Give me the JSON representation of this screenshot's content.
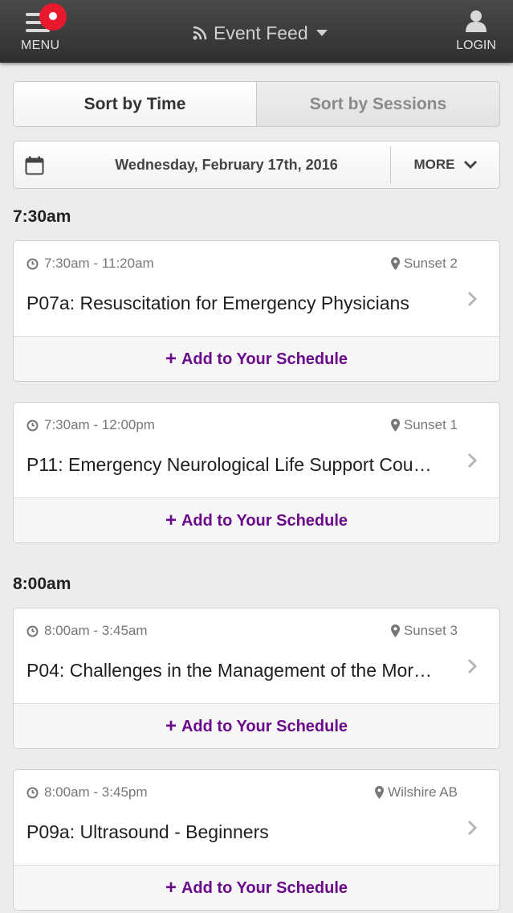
{
  "header": {
    "menu_label": "MENU",
    "title": "Event Feed",
    "login_label": "LOGIN",
    "icons": [
      "hamburger-icon",
      "rss-icon",
      "caret-down-icon",
      "user-icon"
    ],
    "notification_color": "#e8192c"
  },
  "sort": {
    "time_label": "Sort by Time",
    "sessions_label": "Sort by Sessions",
    "selected": "Sort by Time"
  },
  "date_bar": {
    "date": "Wednesday, February 17th, 2016",
    "more_label": "MORE"
  },
  "sections": [
    {
      "time": "7:30am",
      "sessions": [
        {
          "time_range": "7:30am - 11:20am",
          "location": "Sunset 2",
          "title": "P07a: Resuscitation for Emergency Physicians",
          "action": "Add to Your Schedule"
        },
        {
          "time_range": "7:30am - 12:00pm",
          "location": "Sunset 1",
          "title": "P11: Emergency Neurological Life Support Cou…",
          "action": "Add to Your Schedule"
        }
      ]
    },
    {
      "time": "8:00am",
      "sessions": [
        {
          "time_range": "8:00am - 3:45am",
          "location": "Sunset 3",
          "title": "P04: Challenges in the Management of the Mor…",
          "action": "Add to Your Schedule"
        },
        {
          "time_range": "8:00am - 3:45pm",
          "location": "Wilshire AB",
          "title": "P09a: Ultrasound - Beginners",
          "action": "Add to Your Schedule"
        }
      ]
    }
  ],
  "colors": {
    "accent": "#6a0a8a",
    "header_bg": "#3a3a3a",
    "page_bg": "#ececec"
  }
}
